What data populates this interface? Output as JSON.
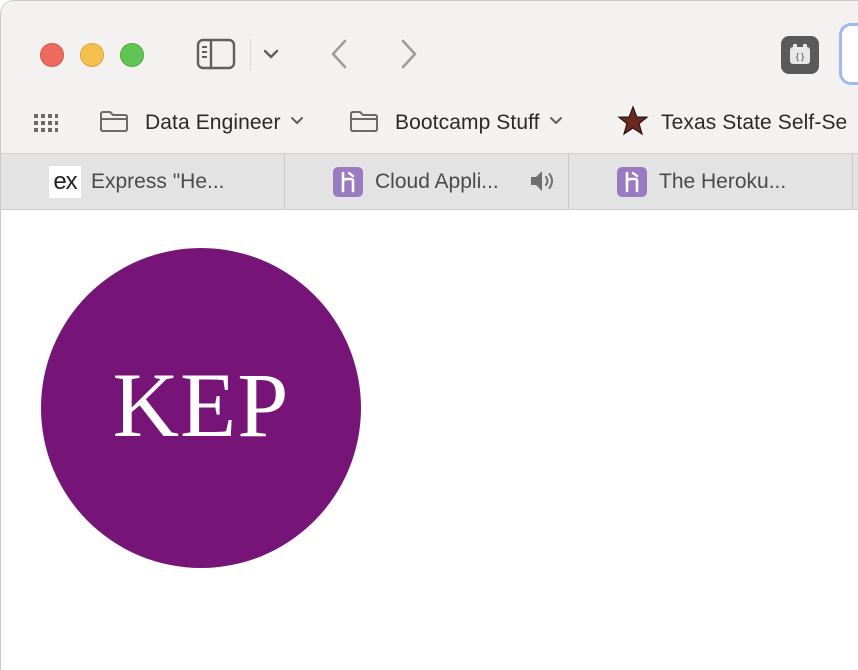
{
  "window": {
    "traffic_lights": [
      "close",
      "minimize",
      "zoom"
    ]
  },
  "toolbar": {
    "icons": [
      "sidebar-icon",
      "chevron-down-icon",
      "back-arrow-icon",
      "forward-arrow-icon",
      "extension-icon"
    ]
  },
  "bookmarks": {
    "items": [
      {
        "label": "Data Engineer",
        "icon": "folder-icon",
        "has_menu": true
      },
      {
        "label": "Bootcamp Stuff",
        "icon": "folder-icon",
        "has_menu": true
      },
      {
        "label": "Texas State Self-Se",
        "icon": "star-icon",
        "has_menu": false
      }
    ]
  },
  "tabs": [
    {
      "title": "Express \"He...",
      "favicon": "ex",
      "favicon_text": "ex"
    },
    {
      "title": "Cloud Appli...",
      "favicon": "heroku-icon",
      "audio": true
    },
    {
      "title": "The Heroku...",
      "favicon": "heroku-icon"
    }
  ],
  "page": {
    "avatar_initials": "KEP",
    "avatar_color": "#771477"
  }
}
